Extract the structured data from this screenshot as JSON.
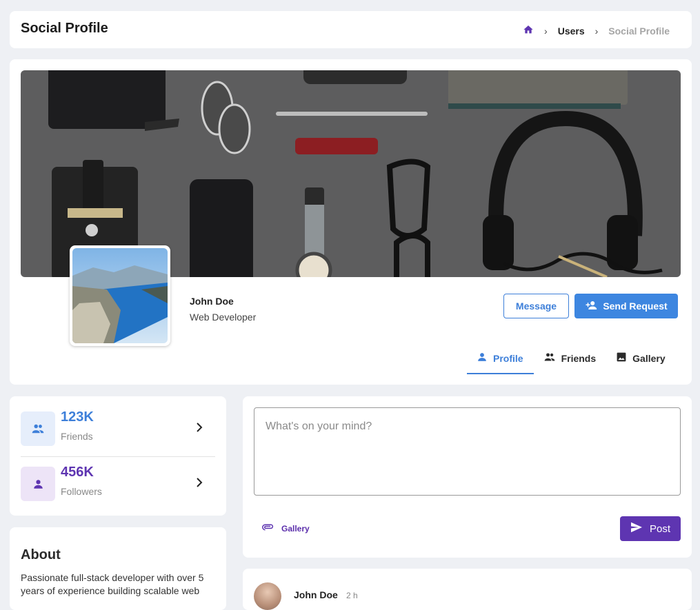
{
  "header": {
    "title": "Social Profile",
    "breadcrumb": [
      {
        "label": "Users"
      },
      {
        "label": "Social Profile"
      }
    ]
  },
  "profile": {
    "name": "John Doe",
    "role": "Web Developer",
    "message_label": "Message",
    "request_label": "Send Request",
    "tabs": [
      {
        "label": "Profile",
        "icon": "person-icon",
        "active": true
      },
      {
        "label": "Friends",
        "icon": "people-icon",
        "active": false
      },
      {
        "label": "Gallery",
        "icon": "image-icon",
        "active": false
      }
    ]
  },
  "stats": [
    {
      "value": "123K",
      "label": "Friends",
      "icon": "people-icon",
      "color": "#3d7fd9",
      "bg": "#e6eefb"
    },
    {
      "value": "456K",
      "label": "Followers",
      "icon": "person-icon",
      "color": "#5e35b1",
      "bg": "#ede4f7"
    }
  ],
  "about": {
    "title": "About",
    "text": "Passionate full-stack developer with over 5 years of experience building scalable web"
  },
  "composer": {
    "placeholder": "What's on your mind?",
    "attach_label": "Gallery",
    "post_label": "Post"
  },
  "post": {
    "author": "John Doe",
    "time": "2 h"
  },
  "colors": {
    "primary": "#3d7fd9",
    "secondary": "#5e35b1",
    "background": "#eef0f4"
  }
}
